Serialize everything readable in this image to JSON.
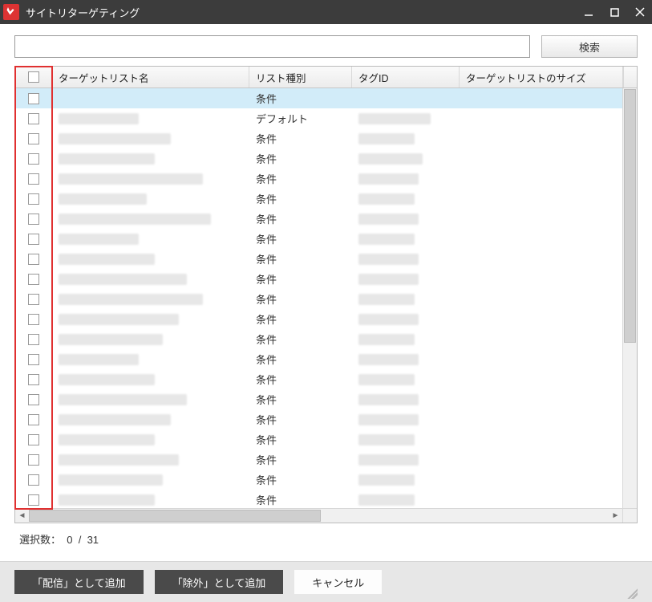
{
  "window": {
    "title": "サイトリターゲティング"
  },
  "search": {
    "value": "",
    "button": "検索"
  },
  "columns": {
    "name": "ターゲットリスト名",
    "type": "リスト種別",
    "tag": "タグID",
    "size": "ターゲットリストのサイズ"
  },
  "list_types": {
    "condition": "条件",
    "default": "デフォルト"
  },
  "rows": [
    {
      "selected": true,
      "type_key": "condition",
      "name_blur": 0,
      "tag_blur": 0
    },
    {
      "selected": false,
      "type_key": "default",
      "name_blur": 100,
      "tag_blur": 90
    },
    {
      "selected": false,
      "type_key": "condition",
      "name_blur": 140,
      "tag_blur": 70
    },
    {
      "selected": false,
      "type_key": "condition",
      "name_blur": 120,
      "tag_blur": 80
    },
    {
      "selected": false,
      "type_key": "condition",
      "name_blur": 180,
      "tag_blur": 75
    },
    {
      "selected": false,
      "type_key": "condition",
      "name_blur": 110,
      "tag_blur": 70
    },
    {
      "selected": false,
      "type_key": "condition",
      "name_blur": 190,
      "tag_blur": 75
    },
    {
      "selected": false,
      "type_key": "condition",
      "name_blur": 100,
      "tag_blur": 70
    },
    {
      "selected": false,
      "type_key": "condition",
      "name_blur": 120,
      "tag_blur": 75
    },
    {
      "selected": false,
      "type_key": "condition",
      "name_blur": 160,
      "tag_blur": 75
    },
    {
      "selected": false,
      "type_key": "condition",
      "name_blur": 180,
      "tag_blur": 70
    },
    {
      "selected": false,
      "type_key": "condition",
      "name_blur": 150,
      "tag_blur": 75
    },
    {
      "selected": false,
      "type_key": "condition",
      "name_blur": 130,
      "tag_blur": 70
    },
    {
      "selected": false,
      "type_key": "condition",
      "name_blur": 100,
      "tag_blur": 75
    },
    {
      "selected": false,
      "type_key": "condition",
      "name_blur": 120,
      "tag_blur": 70
    },
    {
      "selected": false,
      "type_key": "condition",
      "name_blur": 160,
      "tag_blur": 75
    },
    {
      "selected": false,
      "type_key": "condition",
      "name_blur": 140,
      "tag_blur": 75
    },
    {
      "selected": false,
      "type_key": "condition",
      "name_blur": 120,
      "tag_blur": 70
    },
    {
      "selected": false,
      "type_key": "condition",
      "name_blur": 150,
      "tag_blur": 75
    },
    {
      "selected": false,
      "type_key": "condition",
      "name_blur": 130,
      "tag_blur": 70
    },
    {
      "selected": false,
      "type_key": "condition",
      "name_blur": 120,
      "tag_blur": 70
    }
  ],
  "status": {
    "label": "選択数：",
    "selected": 0,
    "separator": "/",
    "total": 31
  },
  "footer": {
    "add_delivery": "「配信」として追加",
    "add_exclude": "「除外」として追加",
    "cancel": "キャンセル"
  }
}
